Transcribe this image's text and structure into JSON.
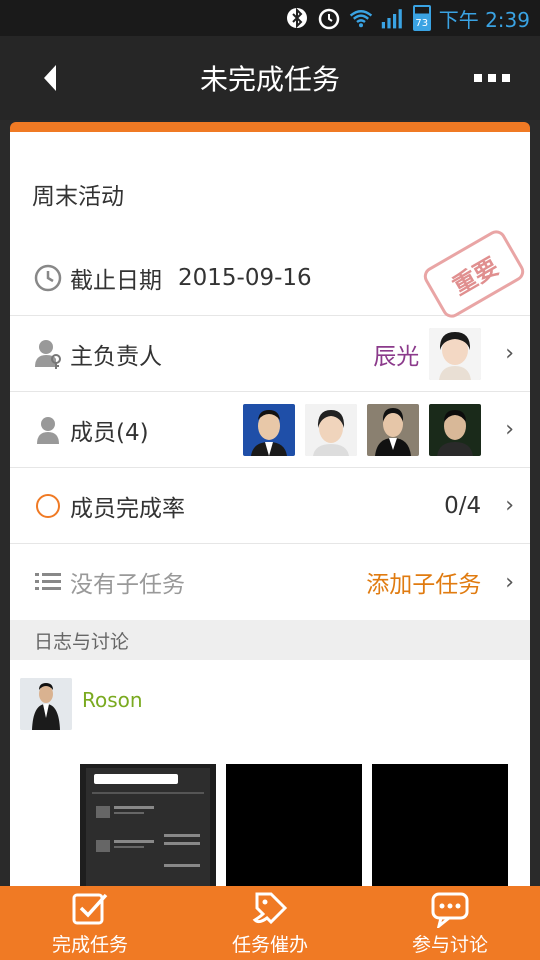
{
  "status_bar": {
    "battery": "73",
    "time": "下午 2:39"
  },
  "header": {
    "title": "未完成任务"
  },
  "task": {
    "title": "周末活动",
    "deadline_label": "截止日期",
    "deadline_value": "2015-09-16",
    "stamp": "重要",
    "owner_label": "主负责人",
    "owner_name": "辰光",
    "members_label": "成员(4)",
    "completion_label": "成员完成率",
    "completion_value": "0/4",
    "subtask_label": "没有子任务",
    "add_subtask": "添加子任务"
  },
  "log": {
    "section_title": "日志与讨论",
    "entries": [
      {
        "user": "Roson"
      }
    ]
  },
  "toolbar": {
    "complete": "完成任务",
    "remind": "任务催办",
    "discuss": "参与讨论"
  },
  "colors": {
    "accent": "#f07a24",
    "owner": "#8b3a8b",
    "add_link": "#e07b10",
    "user_name": "#7aaa20"
  }
}
